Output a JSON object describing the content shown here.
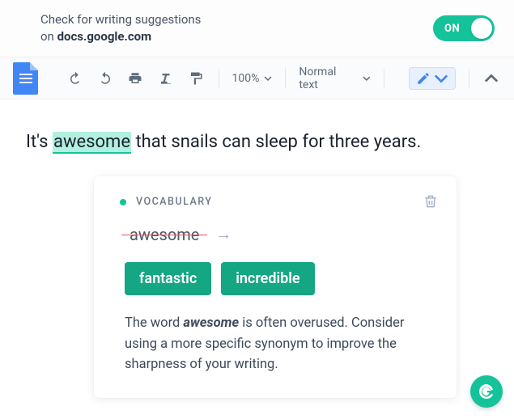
{
  "header": {
    "prompt_line1": "Check for writing suggestions",
    "prompt_prefix": "on ",
    "domain": "docs.google.com",
    "toggle_label": "ON",
    "toggle_on": true
  },
  "toolbar": {
    "zoom": "100%",
    "text_style": "Normal text"
  },
  "document": {
    "before": "It's ",
    "highlighted_word": "awesome",
    "after": " that snails can sleep for three years."
  },
  "card": {
    "category_label": "VOCABULARY",
    "strike_word": "awesome",
    "suggestions": [
      "fantastic",
      "incredible"
    ],
    "explanation_pre": "The word ",
    "explanation_word": "awesome",
    "explanation_post": " is often overused. Consider using a more specific synonym to improve the sharpness of your writing."
  },
  "badge": {
    "letter": "G"
  }
}
